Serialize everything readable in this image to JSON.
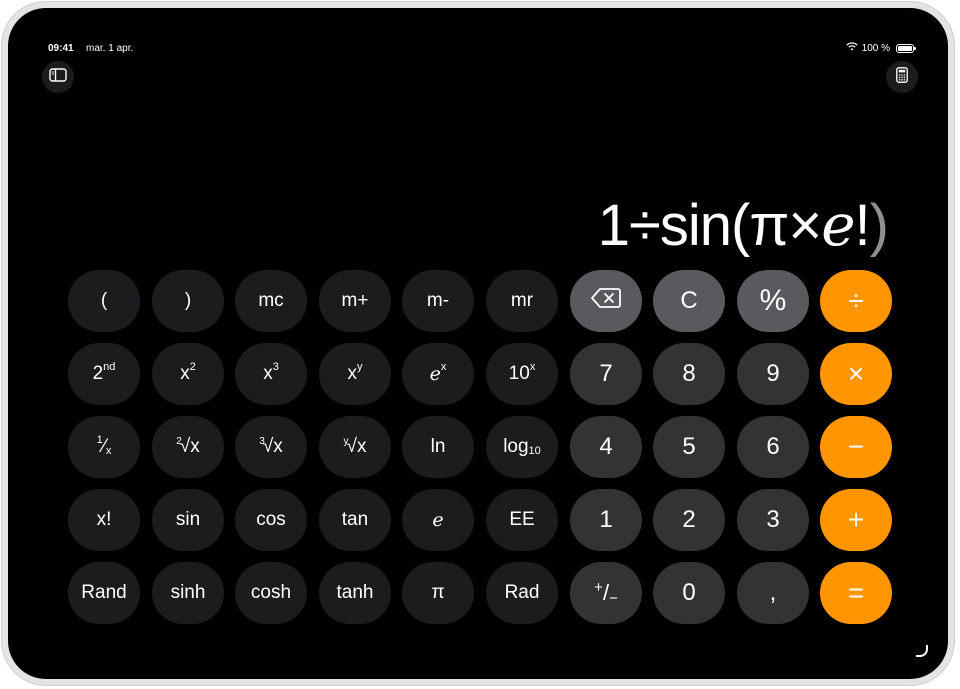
{
  "status_bar": {
    "time": "09:41",
    "date": "mar. 1 apr.",
    "battery_text": "100 %",
    "icons": [
      "wifi-icon",
      "battery-icon"
    ]
  },
  "toolbar": {
    "left_icon": "sidebar-icon",
    "right_icon": "calculator-icon"
  },
  "display": {
    "parts": [
      "1÷sin(π×",
      "e",
      "!",
      ")"
    ]
  },
  "keys": {
    "open_paren": "(",
    "close_paren": ")",
    "mc": "mc",
    "m_plus": "m+",
    "m_minus": "m-",
    "mr": "mr",
    "backspace_icon": "backspace-icon",
    "clear": "C",
    "percent": "%",
    "divide": "÷",
    "second_base": "2",
    "second_sup": "nd",
    "x_base": "x",
    "sq_sup": "2",
    "cube_sup": "3",
    "y_sup": "y",
    "e": "e",
    "ex_sup": "x",
    "ten": "10",
    "seven": "7",
    "eight": "8",
    "nine": "9",
    "multiply": "×",
    "recip_one": "1",
    "recip_slash": "⁄",
    "recip_x": "x",
    "root2_idx": "2",
    "root3_idx": "3",
    "rooty_idx": "y",
    "root_sign": "√",
    "root_x": "x",
    "ln": "ln",
    "log": "log",
    "log_sub": "10",
    "four": "4",
    "five": "5",
    "six": "6",
    "minus": "−",
    "factorial": "x!",
    "sin": "sin",
    "cos": "cos",
    "tan": "tan",
    "ee": "EE",
    "one": "1",
    "two": "2",
    "three": "3",
    "plus": "+",
    "rand": "Rand",
    "sinh": "sinh",
    "cosh": "cosh",
    "tanh": "tanh",
    "pi": "π",
    "rad": "Rad",
    "sign_plus": "+",
    "sign_slash": "/",
    "sign_minus": "−",
    "zero": "0",
    "comma": ",",
    "equals": "="
  },
  "colors": {
    "operator": "#ff9500",
    "function_key": "#5a5a5e",
    "number_key": "#333335",
    "scientific_key": "#1c1c1e",
    "background": "#000000"
  }
}
